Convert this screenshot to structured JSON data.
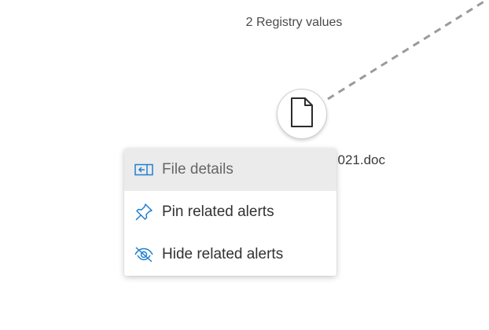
{
  "graph": {
    "group_label": "2 Registry values",
    "file_node": {
      "icon": "document-icon",
      "label": "021.doc"
    }
  },
  "context_menu": {
    "items": [
      {
        "label": "File details",
        "icon": "file-details-icon",
        "highlighted": true
      },
      {
        "label": "Pin related alerts",
        "icon": "pin-icon",
        "highlighted": false
      },
      {
        "label": "Hide related alerts",
        "icon": "eye-hidden-icon",
        "highlighted": false
      }
    ]
  },
  "colors": {
    "accent_icon": "#1f7fd1",
    "text": "#323232",
    "hover_bg": "#ebebeb",
    "edge": "#9a9a9a"
  }
}
